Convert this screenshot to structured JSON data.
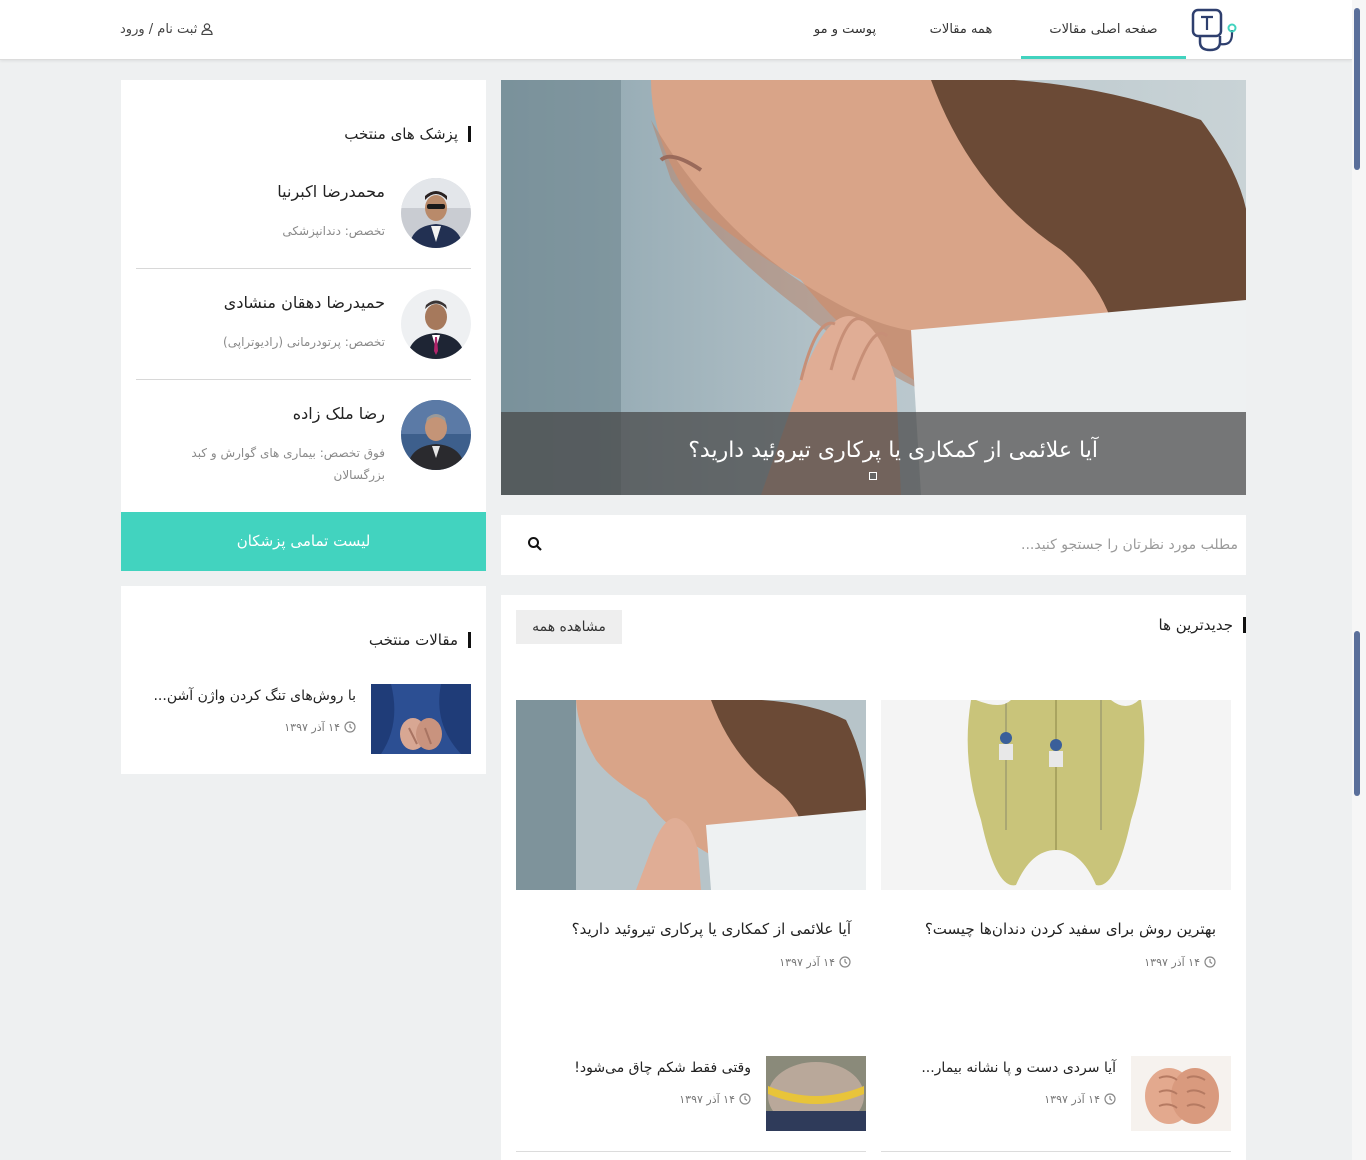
{
  "header": {
    "nav": [
      {
        "label": "صفحه اصلی مقالات",
        "active": true
      },
      {
        "label": "همه مقالات",
        "active": false
      },
      {
        "label": "پوست و مو",
        "active": false
      }
    ],
    "auth_label": "ثبت نام / ورود",
    "accent_color": "#42d3bf",
    "logo_icon": "stethoscope-t-logo"
  },
  "doctors": {
    "title": "پزشک های منتخب",
    "items": [
      {
        "name": "محمدرضا اکبرنیا",
        "specialty": "تخصص: دندانپزشکی"
      },
      {
        "name": "حمیدرضا دهقان منشادی",
        "specialty": "تخصص: پرتودرمانی (رادیوتراپی)"
      },
      {
        "name": "رضا ملک زاده",
        "specialty": "فوق تخصص: بیماری های گوارش و کبد بزرگسالان"
      }
    ],
    "list_button": "لیست تمامی پزشکان"
  },
  "featured": {
    "title": "مقالات منتخب",
    "items": [
      {
        "title": "با روش‌های تنگ کردن واژن آشن...",
        "date": "۱۴ آذر ۱۳۹۷"
      }
    ]
  },
  "hero": {
    "title": "آیا علائمی از کمکاری یا پرکاری تیروئید دارید؟"
  },
  "search": {
    "placeholder": "مطلب مورد نظرتان را جستجو کنید..."
  },
  "latest": {
    "title": "جدیدترین ها",
    "see_all": "مشاهده همه",
    "cards": [
      {
        "title": "بهترین روش برای سفید کردن دندان‌ها چیست؟",
        "date": "۱۴ آذر ۱۳۹۷"
      },
      {
        "title": "آیا علائمی از کمکاری یا پرکاری تیروئید دارید؟",
        "date": "۱۴ آذر ۱۳۹۷"
      }
    ],
    "small": [
      {
        "title": "آیا سردی دست و پا نشانه بیمار...",
        "date": "۱۴ آذر ۱۳۹۷"
      },
      {
        "title": "وقتی فقط شکم چاق می‌شود!",
        "date": "۱۴ آذر ۱۳۹۷"
      }
    ]
  }
}
